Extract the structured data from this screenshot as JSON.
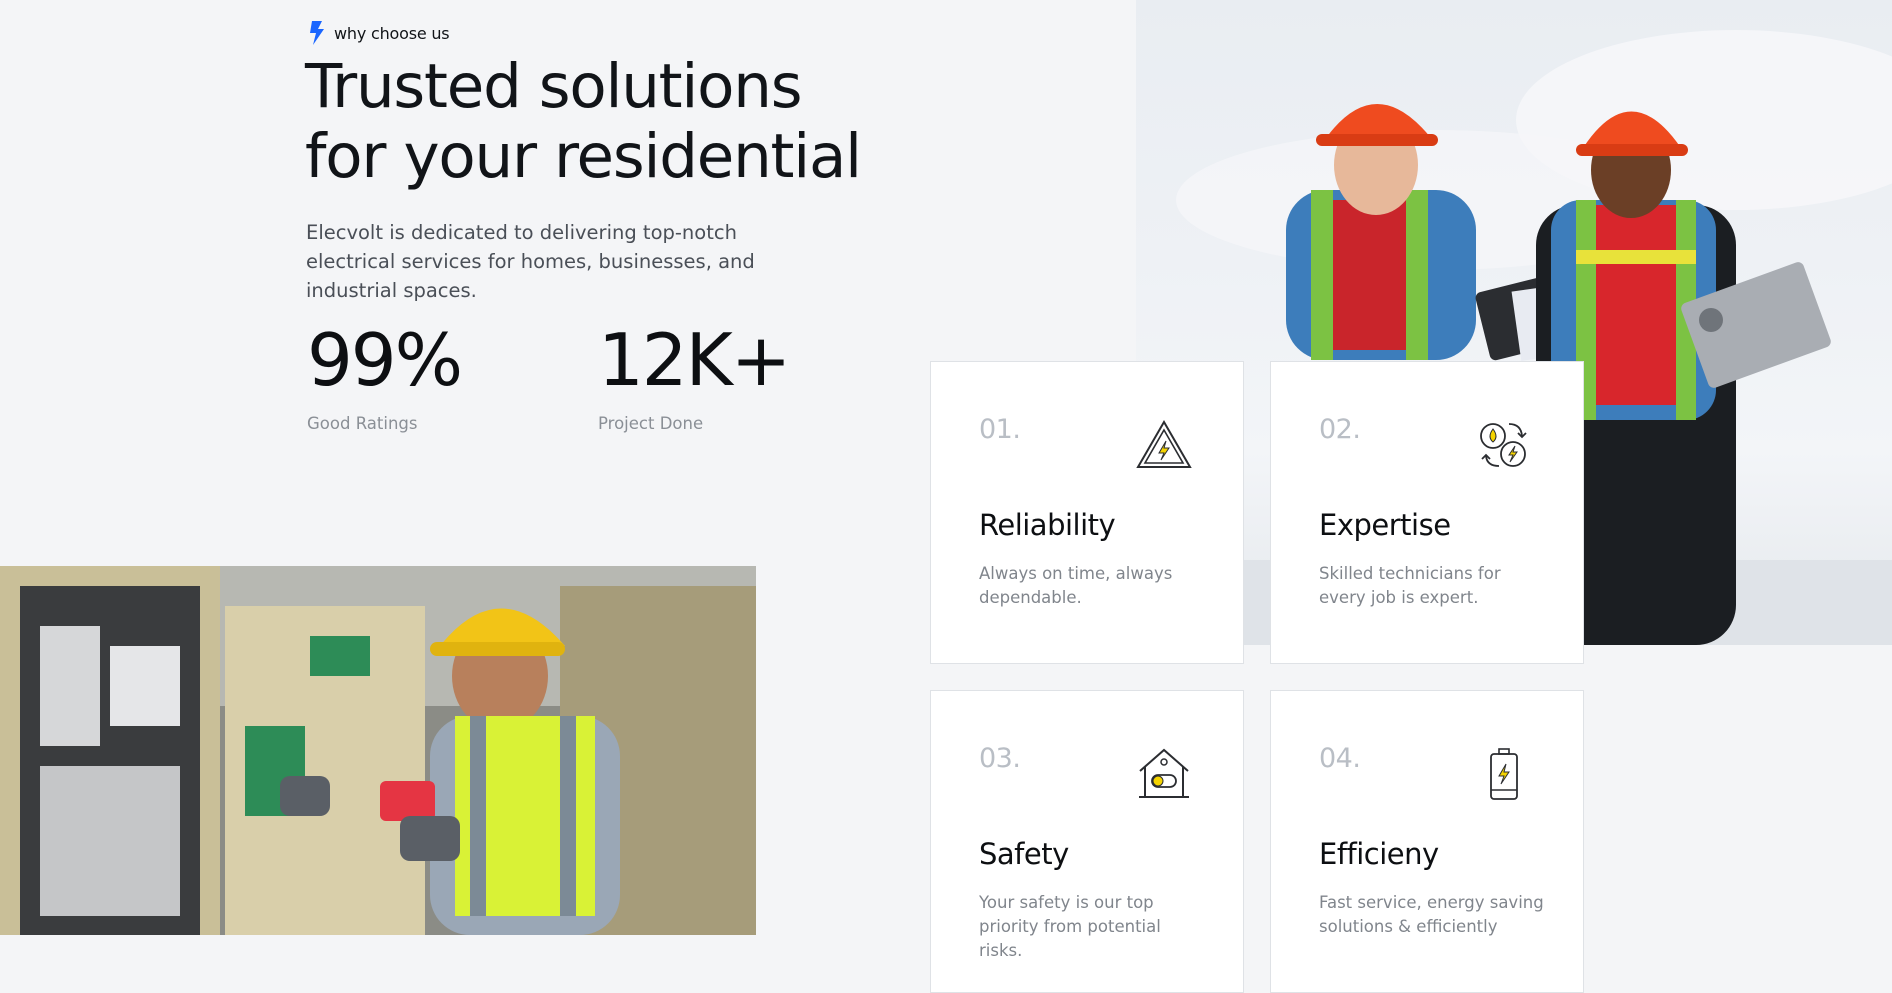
{
  "section": {
    "eyebrow": "why choose us",
    "headline_line1": "Trusted solutions",
    "headline_line2": "for your residential",
    "intro": "Elecvolt is dedicated to delivering top-notch electrical services for homes, businesses, and industrial spaces."
  },
  "stats": [
    {
      "value": "99%",
      "label": "Good Ratings"
    },
    {
      "value": "12K+",
      "label": "Project Done"
    }
  ],
  "features": [
    {
      "index": "01.",
      "title": "Reliability",
      "desc": "Always on time, always dependable.",
      "icon": "warning-bolt-icon"
    },
    {
      "index": "02.",
      "title": "Expertise",
      "desc": "Skilled technicians for every job is expert.",
      "icon": "energy-exchange-icon"
    },
    {
      "index": "03.",
      "title": "Safety",
      "desc": "Your safety is our top priority from potential risks.",
      "icon": "home-switch-icon"
    },
    {
      "index": "04.",
      "title": "Efficieny",
      "desc": "Fast service, energy saving solutions & efficiently",
      "icon": "battery-bolt-icon"
    }
  ],
  "colors": {
    "accent": "#1a66ff",
    "bolt_yellow": "#f5d400",
    "background": "#f4f5f7"
  }
}
